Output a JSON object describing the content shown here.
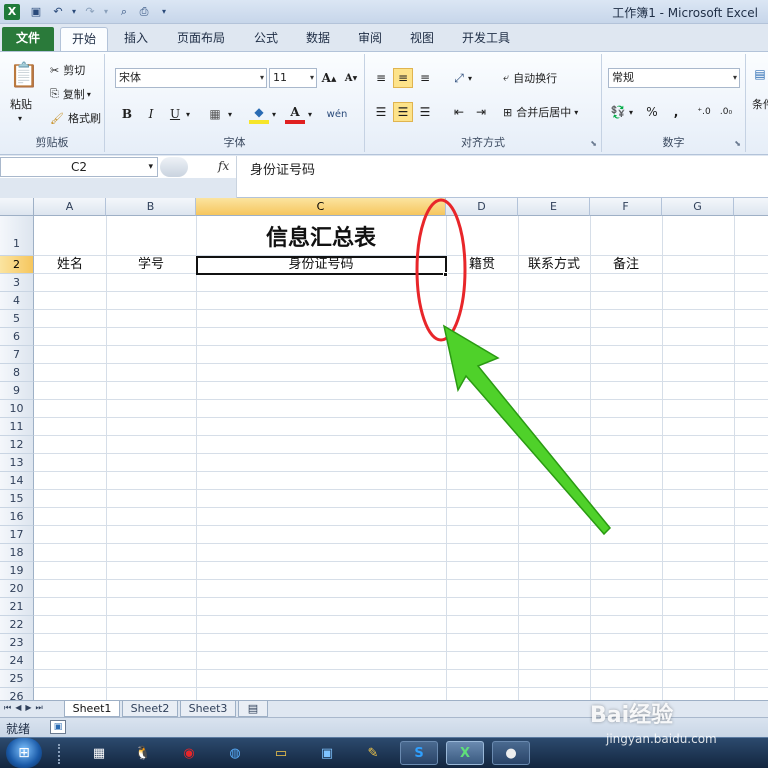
{
  "window": {
    "title": "工作簿1 - Microsoft Excel"
  },
  "quick_access": [
    {
      "icon": "excel-logo-icon"
    },
    {
      "icon": "save-icon"
    },
    {
      "icon": "undo-icon"
    },
    {
      "icon": "redo-icon"
    },
    {
      "icon": "print-preview-icon"
    },
    {
      "icon": "print-icon"
    },
    {
      "icon": "customize-toolbar-icon"
    }
  ],
  "tabs": [
    "文件",
    "开始",
    "插入",
    "页面布局",
    "公式",
    "数据",
    "审阅",
    "视图",
    "开发工具"
  ],
  "ribbon": {
    "clipboard": {
      "paste": "粘贴",
      "cut": "剪切",
      "copy": "复制",
      "format_painter": "格式刷",
      "label": "剪贴板"
    },
    "font": {
      "font_name": "宋体",
      "font_size": "11",
      "label": "字体"
    },
    "alignment": {
      "wrap_text": "自动换行",
      "merge_center": "合并后居中",
      "label": "对齐方式"
    },
    "number": {
      "format": "常规",
      "percent": "%",
      "comma": ",",
      "label": "数字"
    },
    "styles": {
      "cond_format": "条件"
    }
  },
  "formula_bar": {
    "name_box": "C2",
    "fx": "fx",
    "value": "身份证号码"
  },
  "sheet": {
    "columns": [
      "A",
      "B",
      "C",
      "D",
      "E",
      "F",
      "G",
      ""
    ],
    "active_column": "C",
    "rows": [
      "1",
      "2",
      "3",
      "4",
      "5",
      "6",
      "7",
      "8",
      "9",
      "10",
      "11",
      "12",
      "13",
      "14",
      "15",
      "16",
      "17",
      "18",
      "19",
      "20",
      "21",
      "22",
      "23",
      "24",
      "25",
      "26"
    ],
    "active_row": "2",
    "title": "信息汇总表",
    "headers": [
      "姓名",
      "学号",
      "身份证号码",
      "籍贯",
      "联系方式",
      "备注"
    ]
  },
  "sheet_tabs": [
    "Sheet1",
    "Sheet2",
    "Sheet3"
  ],
  "status": {
    "ready": "就绪"
  },
  "taskbar": {
    "start": "start-orb",
    "items": [
      "taskbar-explorer",
      "taskbar-qq",
      "taskbar-netease",
      "taskbar-browser",
      "taskbar-folder",
      "taskbar-picture",
      "taskbar-paint",
      "taskbar-sogou",
      "taskbar-excel",
      "taskbar-app"
    ]
  },
  "watermark": {
    "brand": "Bai经验",
    "url": "jingyan.baidu.com"
  }
}
